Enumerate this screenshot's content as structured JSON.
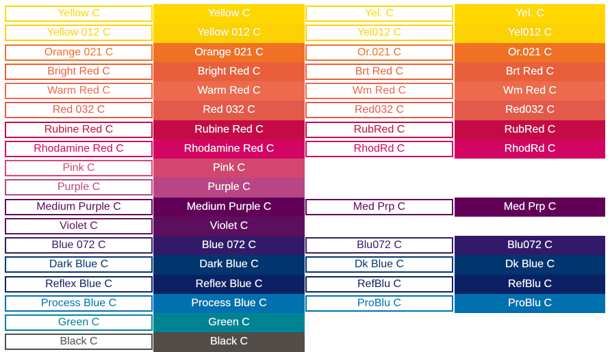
{
  "swatches": [
    {
      "name": "Yellow C",
      "short": "Yel. C",
      "color": "#FED800"
    },
    {
      "name": "Yellow 012 C",
      "short": "Yel012 C",
      "color": "#FCD205"
    },
    {
      "name": "Orange 021 C",
      "short": "Or.021 C",
      "color": "#F07124"
    },
    {
      "name": "Bright Red C",
      "short": "Brt Red C",
      "color": "#E95F3C"
    },
    {
      "name": "Warm Red C",
      "short": "Wm Red C",
      "color": "#EE6A4C"
    },
    {
      "name": "Red 032 C",
      "short": "Red032 C",
      "color": "#E35A4B"
    },
    {
      "name": "Rubine Red C",
      "short": "RubRed C",
      "color": "#C50B45"
    },
    {
      "name": "Rhodamine Red C",
      "short": "RhodRd C",
      "color": "#D30562"
    },
    {
      "name": "Pink C",
      "short": null,
      "color": "#D3476F"
    },
    {
      "name": "Purple C",
      "short": null,
      "color": "#BA4584"
    },
    {
      "name": "Medium Purple C",
      "short": "Med Prp C",
      "color": "#620058"
    },
    {
      "name": "Violet C",
      "short": null,
      "color": "#5E0E5E"
    },
    {
      "name": "Blue 072 C",
      "short": "Blu072 C",
      "color": "#331A69"
    },
    {
      "name": "Dark Blue C",
      "short": "Dk Blue C",
      "color": "#003570"
    },
    {
      "name": "Reflex Blue C",
      "short": "RefBlu C",
      "color": "#0C2163"
    },
    {
      "name": "Process Blue C",
      "short": "ProBlu C",
      "color": "#0070AF"
    },
    {
      "name": "Green C",
      "short": null,
      "color": "#008494"
    },
    {
      "name": "Black C",
      "short": null,
      "color": "#534D49"
    }
  ]
}
